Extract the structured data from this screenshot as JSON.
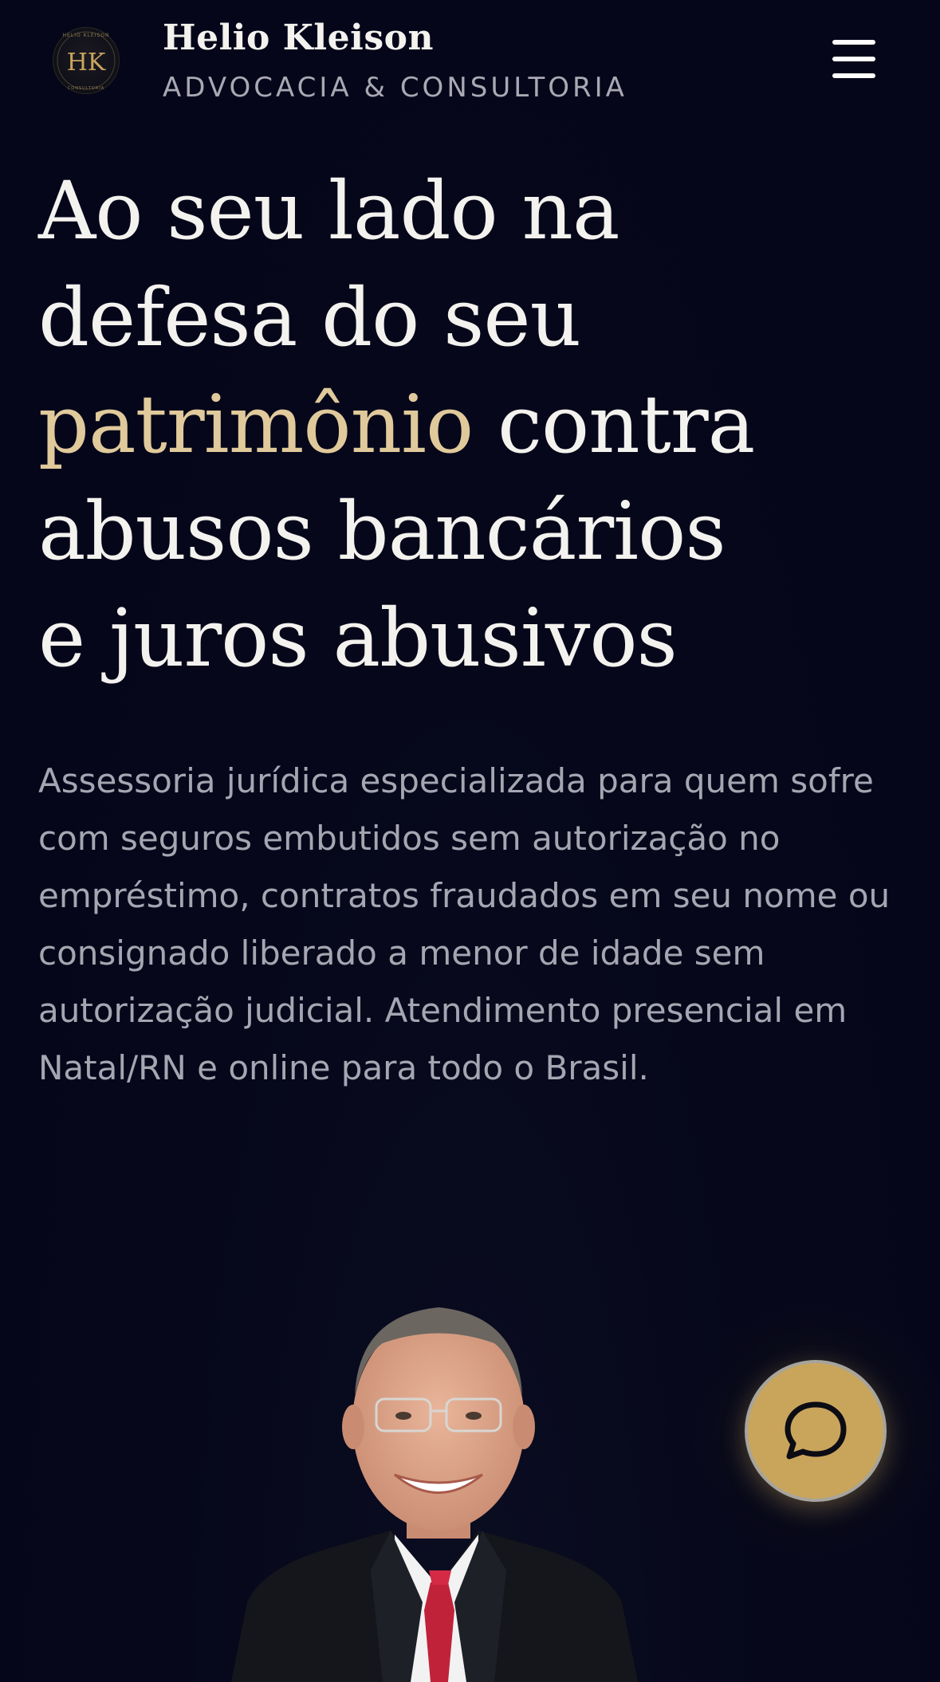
{
  "header": {
    "logo_monogram": "HK",
    "logo_ring_text": "HELIO KLEISON · ADVOCACIA & CONSULTORIA",
    "brand_name": "Helio Kleison",
    "brand_tagline": "ADVOCACIA & CONSULTORIA",
    "menu_icon": "hamburger-menu-icon"
  },
  "hero": {
    "headline": {
      "line1": "Ao seu lado na",
      "line2": "defesa do seu",
      "line3_accent": "patrimônio",
      "line3_rest": " contra",
      "line4": "abusos bancários",
      "line5": "e juros abusivos"
    },
    "description": "Assessoria jurídica especializada para quem sofre com seguros embutidos sem autorização no empréstimo, contratos fraudados em seu nome ou consignado liberado a menor de idade sem autorização judicial. Atendimento presencial em Natal/RN e online para todo o Brasil."
  },
  "chat_button": {
    "icon": "chat-bubble-icon"
  },
  "colors": {
    "background": "#05061a",
    "accent_gold": "#e0c99b",
    "chat_button": "#c9a55c",
    "text_primary": "#f4f2ee",
    "text_secondary": "#a6a6b2"
  }
}
